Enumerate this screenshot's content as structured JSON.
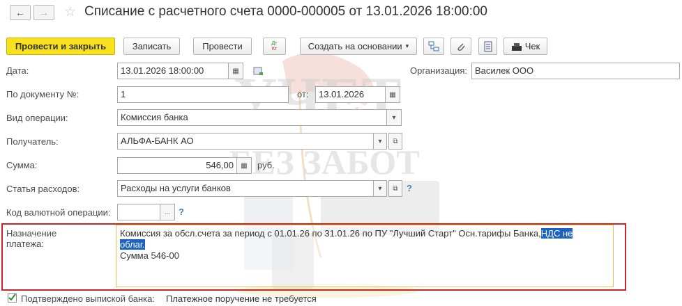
{
  "header": {
    "back_icon": "←",
    "forward_icon": "→",
    "favorite_icon": "☆",
    "title": "Списание с расчетного счета 0000-000005 от 13.01.2026 18:00:00"
  },
  "toolbar": {
    "post_close": "Провести и закрыть",
    "save": "Записать",
    "post": "Провести",
    "dtkt_top": "Дт",
    "dtkt_bottom": "Кт",
    "create_based": "Создать на основании",
    "dropdown_glyph": "▾",
    "receipt": "Чек"
  },
  "form": {
    "date_label": "Дата:",
    "date_value": "13.01.2026 18:00:00",
    "org_label": "Организация:",
    "org_value": "Василек ООО",
    "docnum_label": "По документу №:",
    "docnum_value": "1",
    "from_label": "от:",
    "from_value": "13.01.2026",
    "optype_label": "Вид операции:",
    "optype_value": "Комиссия банка",
    "recipient_label": "Получатель:",
    "recipient_value": "АЛЬФА-БАНК АО",
    "amount_label": "Сумма:",
    "amount_value": "546,00",
    "currency": "руб.",
    "expense_label": "Статья расходов:",
    "expense_value": "Расходы на услуги банков",
    "currency_op_label": "Код валютной операции:",
    "currency_op_value": "",
    "more_glyph": "...",
    "help_glyph": "?",
    "purpose_label": "Назначение платежа:",
    "purpose_line1": "Комиссия за обсл.счета за период с 01.01.26 по 31.01.26 по ПУ \"Лучший Старт\" Осн.тарифы Банка,",
    "purpose_selected_1": "НДС не",
    "purpose_selected_2": "облаг.",
    "purpose_line3": "Сумма 546-00",
    "confirmed_label": "Подтверждено выпиской банка:",
    "confirmed_value": "Платежное поручение не требуется"
  },
  "watermark": {
    "line1": "УЧЕТ",
    "line2": "БЕЗ ЗАБОТ"
  },
  "colors": {
    "primary_button": "#f8e11d",
    "highlight_box": "#c62828",
    "active_field_border": "#e5c14a",
    "selection": "#1c62c4",
    "help": "#3d7ec7"
  }
}
